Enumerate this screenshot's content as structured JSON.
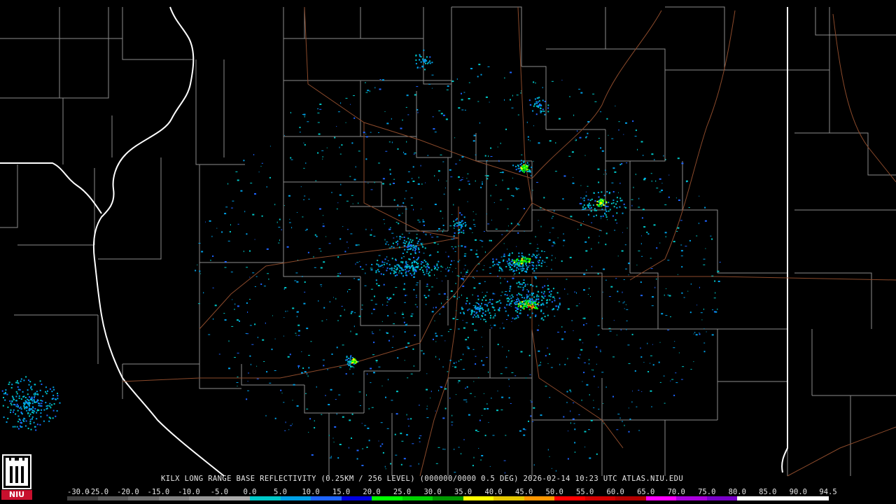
{
  "product": {
    "title": "KILX LONG RANGE BASE REFLECTIVITY (0.25KM / 256 LEVEL) (000000/0000 0.5 DEG) 2026-02-14 10:23 UTC  ATLAS.NIU.EDU"
  },
  "logo": {
    "text": "NIU",
    "color": "#c8102e"
  },
  "legend": {
    "labels": [
      "-30.0",
      "-25.0",
      "-20.0",
      "-15.0",
      "-10.0",
      "-5.0",
      "0.0",
      "5.0",
      "10.0",
      "15.0",
      "20.0",
      "25.0",
      "30.0",
      "35.0",
      "40.0",
      "45.0",
      "50.0",
      "55.0",
      "60.0",
      "65.0",
      "70.0",
      "75.0",
      "80.0",
      "85.0",
      "90.0",
      "94.5"
    ],
    "colors": [
      "#404040",
      "#5a5a5a",
      "#6e6e6e",
      "#828282",
      "#969696",
      "#aaaaaa",
      "#00c8c8",
      "#00a0e6",
      "#1e64ff",
      "#0000e0",
      "#00ff00",
      "#00d000",
      "#009600",
      "#ffff00",
      "#e6c800",
      "#ff9600",
      "#ff0000",
      "#d20000",
      "#b40000",
      "#ff00ff",
      "#aa00dc",
      "#7800c8",
      "#ffffff",
      "#ffffff",
      "#ffffff"
    ]
  },
  "map_style": {
    "county_line_color": "#8c8c8c",
    "state_line_color": "#ffffff",
    "highway_color": "#8b4a2b",
    "background": "#000000"
  }
}
